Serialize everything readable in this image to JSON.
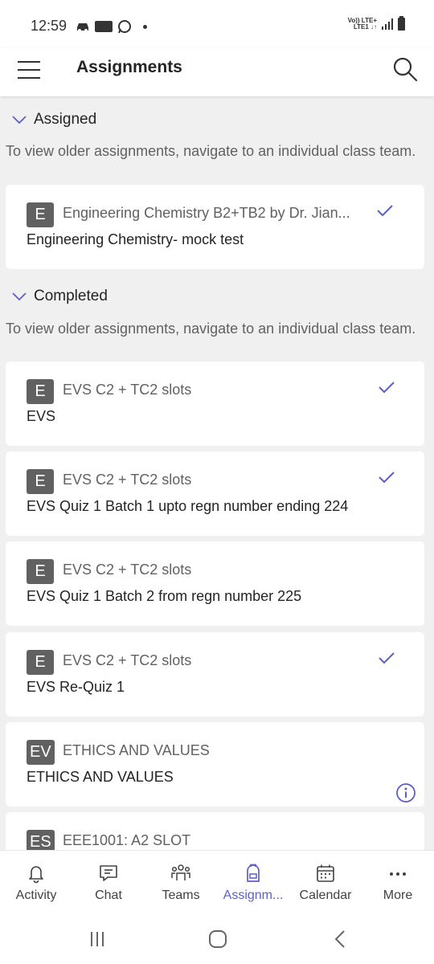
{
  "status_bar": {
    "time": "12:59",
    "network_top": "Vo)) LTE+",
    "network_bottom": "LTE1 ↓↑",
    "icons": [
      "car-icon",
      "app-icon",
      "whatsapp-icon",
      "dot-icon",
      "signal-icon",
      "battery-icon"
    ]
  },
  "header": {
    "title": "Assignments",
    "menu_icon": "hamburger-icon",
    "search_icon": "search-icon"
  },
  "sections": [
    {
      "title": "Assigned",
      "note": "To view older assignments, navigate to an individual class team.",
      "cards": [
        {
          "avatar": "E",
          "class": "Engineering Chemistry B2+TB2 by Dr. Jian...",
          "title": "Engineering Chemistry- mock test",
          "status": "check"
        }
      ]
    },
    {
      "title": "Completed",
      "note": "To view older assignments, navigate to an individual class team.",
      "cards": [
        {
          "avatar": "E",
          "class": "EVS C2 + TC2 slots",
          "title": "EVS",
          "status": "check"
        },
        {
          "avatar": "E",
          "class": "EVS C2 + TC2 slots",
          "title": "EVS Quiz 1 Batch 1 upto regn number ending 224",
          "status": "check"
        },
        {
          "avatar": "E",
          "class": "EVS C2 + TC2 slots",
          "title": "EVS Quiz 1 Batch 2 from regn number 225",
          "status": "none"
        },
        {
          "avatar": "E",
          "class": "EVS C2 + TC2 slots",
          "title": "EVS Re-Quiz 1",
          "status": "check"
        },
        {
          "avatar": "EV",
          "class": "ETHICS AND VALUES",
          "title": "ETHICS AND VALUES",
          "status": "info"
        },
        {
          "avatar": "ES",
          "class": "EEE1001: A2 SLOT",
          "title": "",
          "status": "none"
        }
      ]
    }
  ],
  "bottom_nav": [
    {
      "label": "Activity",
      "icon": "bell-icon",
      "active": false
    },
    {
      "label": "Chat",
      "icon": "chat-icon",
      "active": false
    },
    {
      "label": "Teams",
      "icon": "teams-icon",
      "active": false
    },
    {
      "label": "Assignm...",
      "icon": "backpack-icon",
      "active": true
    },
    {
      "label": "Calendar",
      "icon": "calendar-icon",
      "active": false
    },
    {
      "label": "More",
      "icon": "more-icon",
      "active": false
    }
  ],
  "system_nav": [
    "recents-icon",
    "home-icon",
    "back-icon"
  ],
  "colors": {
    "accent": "#5b5fc7",
    "avatar_bg": "#616161",
    "background": "#f0f0f0",
    "card": "#ffffff"
  }
}
